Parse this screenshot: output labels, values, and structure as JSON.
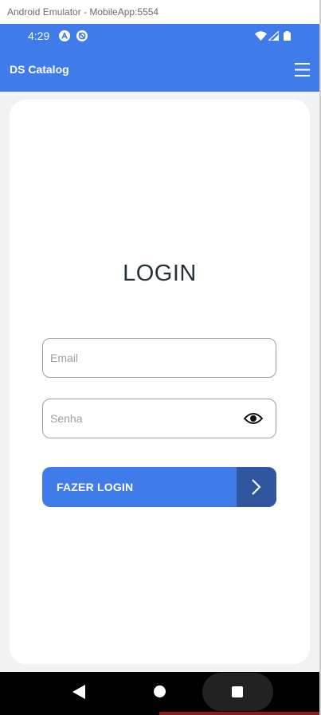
{
  "window": {
    "title": "Android Emulator - MobileApp:5554"
  },
  "status_bar": {
    "time": "4:29",
    "app_icons": [
      "react-native-icon",
      "sync-disabled-icon"
    ],
    "system_icons": [
      "wifi-icon",
      "cell-signal-icon",
      "battery-icon"
    ]
  },
  "header": {
    "title": "DS Catalog",
    "menu_icon": "hamburger-menu-icon"
  },
  "login": {
    "title": "LOGIN",
    "email_placeholder": "Email",
    "email_value": "",
    "password_placeholder": "Senha",
    "password_value": "",
    "password_toggle_icon": "eye-icon",
    "submit_label": "FAZER LOGIN",
    "submit_icon": "chevron-right-icon"
  },
  "nav_bar": {
    "icons": [
      "back-icon",
      "home-icon",
      "recents-icon"
    ]
  },
  "colors": {
    "primary": "#407bea",
    "primary_dark": "#2f569e",
    "text_dark": "#263238",
    "placeholder": "#9e9e9e",
    "background": "#f2f2f2",
    "card": "#ffffff"
  }
}
